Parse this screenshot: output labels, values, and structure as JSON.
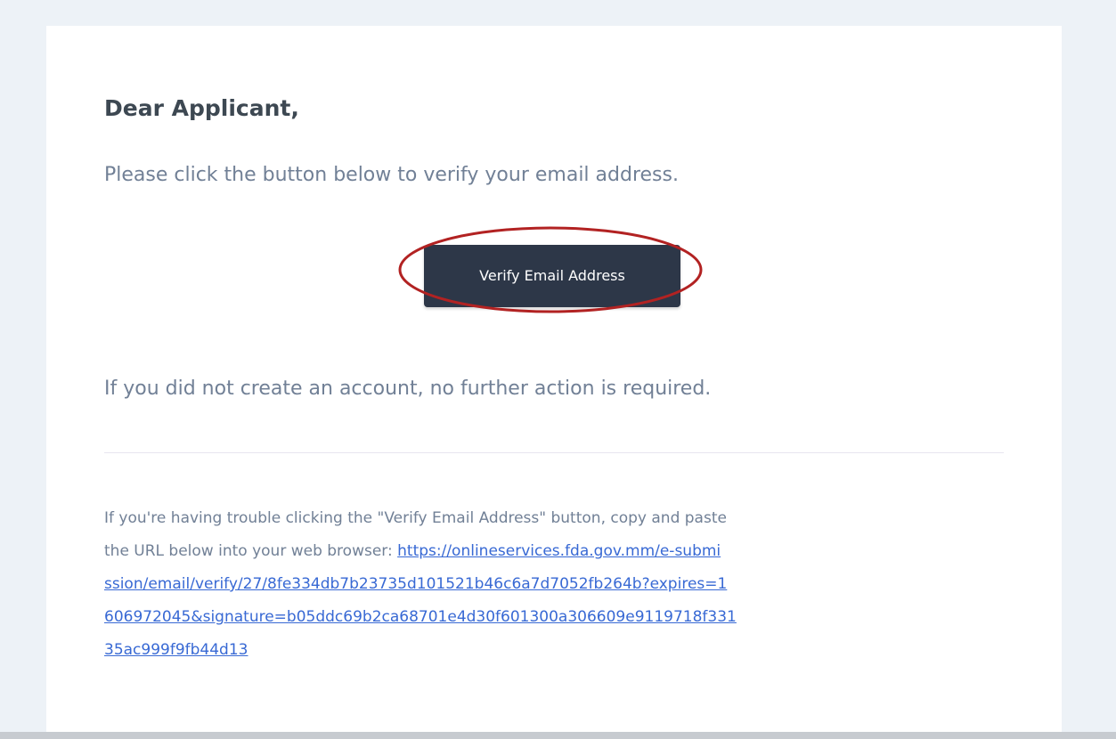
{
  "email": {
    "greeting": "Dear Applicant,",
    "intro": "Please click the button below to verify your email address.",
    "button_label": "Verify Email Address",
    "no_action": "If you did not create an account, no further action is required.",
    "subcopy_text_1": "If you're having trouble clicking the \"Verify Email Address\" button, copy and paste",
    "subcopy_text_2": "the URL below into your web browser: ",
    "url_lines": [
      "https://onlineservices.fda.gov.mm/e-submi",
      "ssion/email/verify/27/8fe334db7b23735d101521b46c6a7d7052fb264b?expires=1",
      "606972045&signature=b05ddc69b2ca68701e4d30f601300a306609e9119718f331",
      "35ac999f9fb44d13"
    ]
  },
  "colors": {
    "page_background": "#edf2f7",
    "card_background": "#ffffff",
    "button_background": "#2d3748",
    "heading_text": "#3d4852",
    "body_text": "#718096",
    "link": "#3869d4",
    "annotation_ellipse": "#b22222"
  }
}
